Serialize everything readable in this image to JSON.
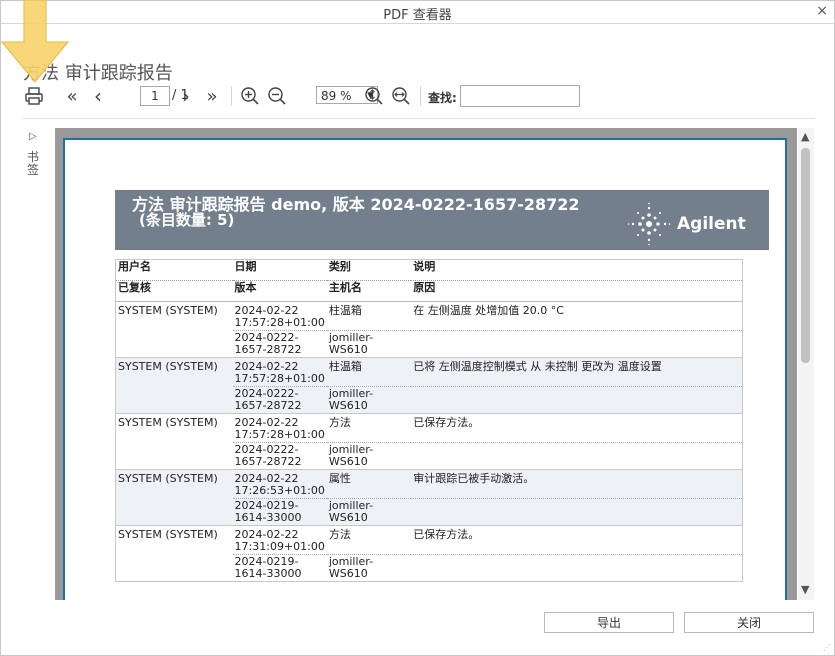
{
  "window": {
    "title": "PDF 查看器",
    "close_glyph": "×"
  },
  "heading": "方法 审计跟踪报告",
  "toolbar": {
    "print_icon": "printer-icon",
    "first_glyph": "«",
    "prev_glyph": "‹",
    "page_current": "1",
    "page_total": "/ 1",
    "next_glyph": "›",
    "last_glyph": "»",
    "zoom_value": "89 %",
    "find_label": "查找:",
    "find_value": ""
  },
  "sidebar": {
    "toggle_glyph": "▷",
    "label": "书签"
  },
  "report": {
    "banner_line1": "方法 审计跟踪报告 demo, 版本 2024-0222-1657-28722",
    "banner_line2": "(条目数量: 5)",
    "brand": "Agilent",
    "headers_row1": [
      "用户名",
      "日期",
      "类别",
      "说明"
    ],
    "headers_row2": [
      "已复核",
      "版本",
      "主机名",
      "原因"
    ],
    "entries": [
      {
        "user": "SYSTEM (SYSTEM)",
        "date": "2024-02-22 17:57:28+01:00",
        "category": "柱温箱",
        "description": "在 左侧温度 处增加值 20.0 °C",
        "version": "2024-0222-1657-28722",
        "host": "jomiller-WS610"
      },
      {
        "user": "SYSTEM (SYSTEM)",
        "date": "2024-02-22 17:57:28+01:00",
        "category": "柱温箱",
        "description": "已将 左侧温度控制模式 从 未控制 更改为 温度设置",
        "version": "2024-0222-1657-28722",
        "host": "jomiller-WS610"
      },
      {
        "user": "SYSTEM (SYSTEM)",
        "date": "2024-02-22 17:57:28+01:00",
        "category": "方法",
        "description": "已保存方法。",
        "version": "2024-0222-1657-28722",
        "host": "jomiller-WS610"
      },
      {
        "user": "SYSTEM (SYSTEM)",
        "date": "2024-02-22 17:26:53+01:00",
        "category": "属性",
        "description": "审计跟踪已被手动激活。",
        "version": "2024-0219-1614-33000",
        "host": "jomiller-WS610"
      },
      {
        "user": "SYSTEM (SYSTEM)",
        "date": "2024-02-22 17:31:09+01:00",
        "category": "方法",
        "description": "已保存方法。",
        "version": "2024-0219-1614-33000",
        "host": "jomiller-WS610"
      }
    ]
  },
  "footer": {
    "export_label": "导出",
    "close_label": "关闭"
  },
  "colors": {
    "banner": "#737f8c",
    "page_border": "#1f6fa6",
    "highlight_arrow": "#f7d36b",
    "row_shade": "#eef1f6"
  }
}
